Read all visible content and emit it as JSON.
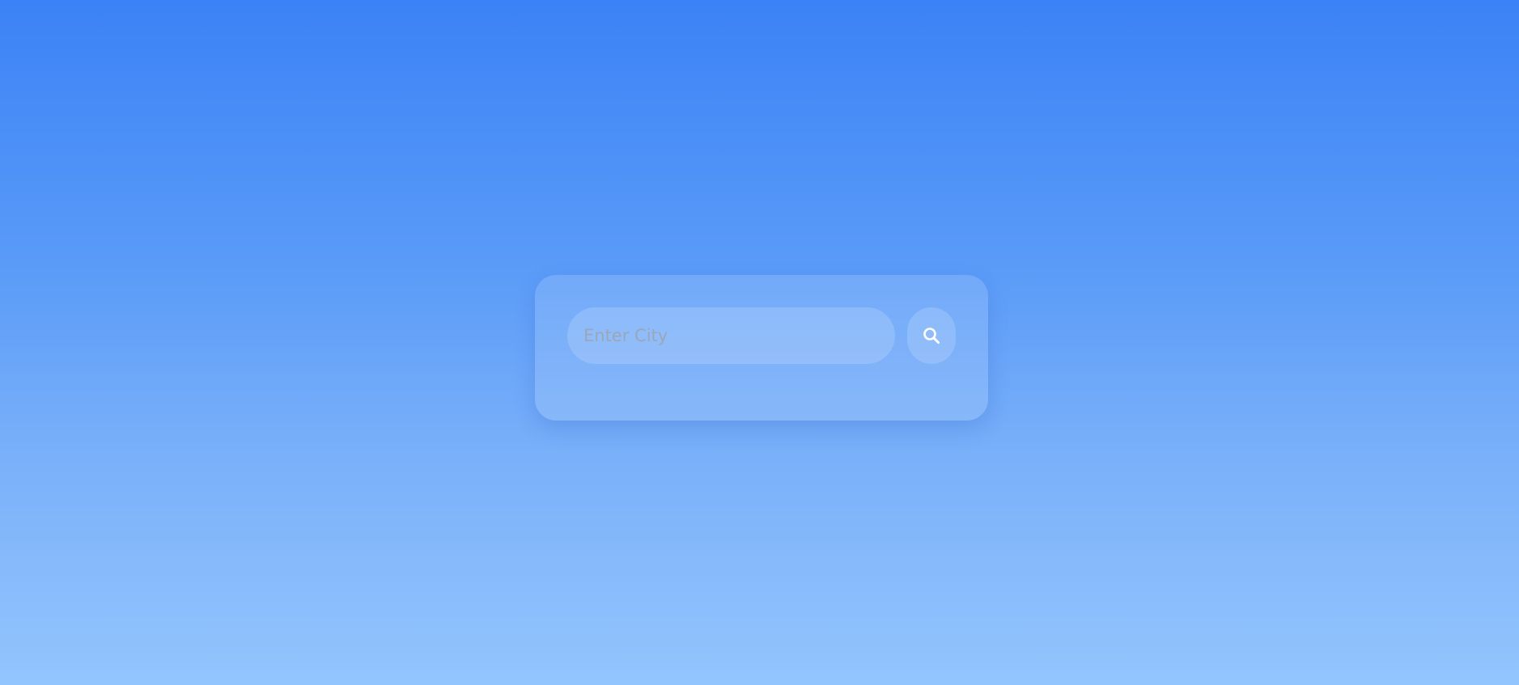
{
  "search": {
    "placeholder": "Enter City",
    "value": "",
    "button_icon": "search-icon"
  },
  "colors": {
    "background_top": "#3b82f6",
    "background_bottom": "#93c5fd",
    "icon": "#ffffff",
    "placeholder": "#9aa7b8"
  }
}
